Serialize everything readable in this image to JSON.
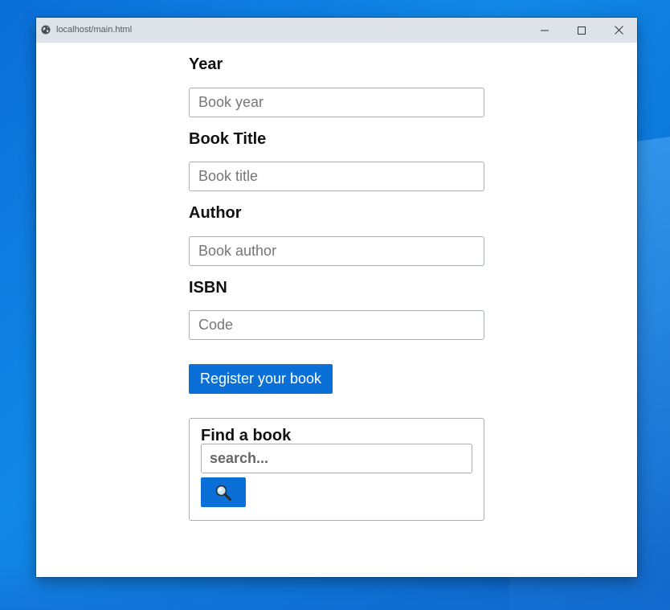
{
  "browser": {
    "url": "localhost/main.html",
    "icons": {
      "site": "globe-icon",
      "minimize": "minimize-icon",
      "maximize": "maximize-icon",
      "close": "close-icon"
    }
  },
  "form": {
    "year": {
      "label": "Year",
      "placeholder": "Book year",
      "value": ""
    },
    "title": {
      "label": "Book Title",
      "placeholder": "Book title",
      "value": ""
    },
    "author": {
      "label": "Author",
      "placeholder": "Book author",
      "value": ""
    },
    "isbn": {
      "label": "ISBN",
      "placeholder": "Code",
      "value": ""
    },
    "submit_label": "Register your book"
  },
  "search": {
    "title": "Find a book",
    "placeholder": "search...",
    "value": "",
    "button_icon": "magnifier-icon"
  },
  "colors": {
    "accent": "#0a6fd6",
    "titlebar": "#dee3ea",
    "border": "#a9aeb4"
  }
}
